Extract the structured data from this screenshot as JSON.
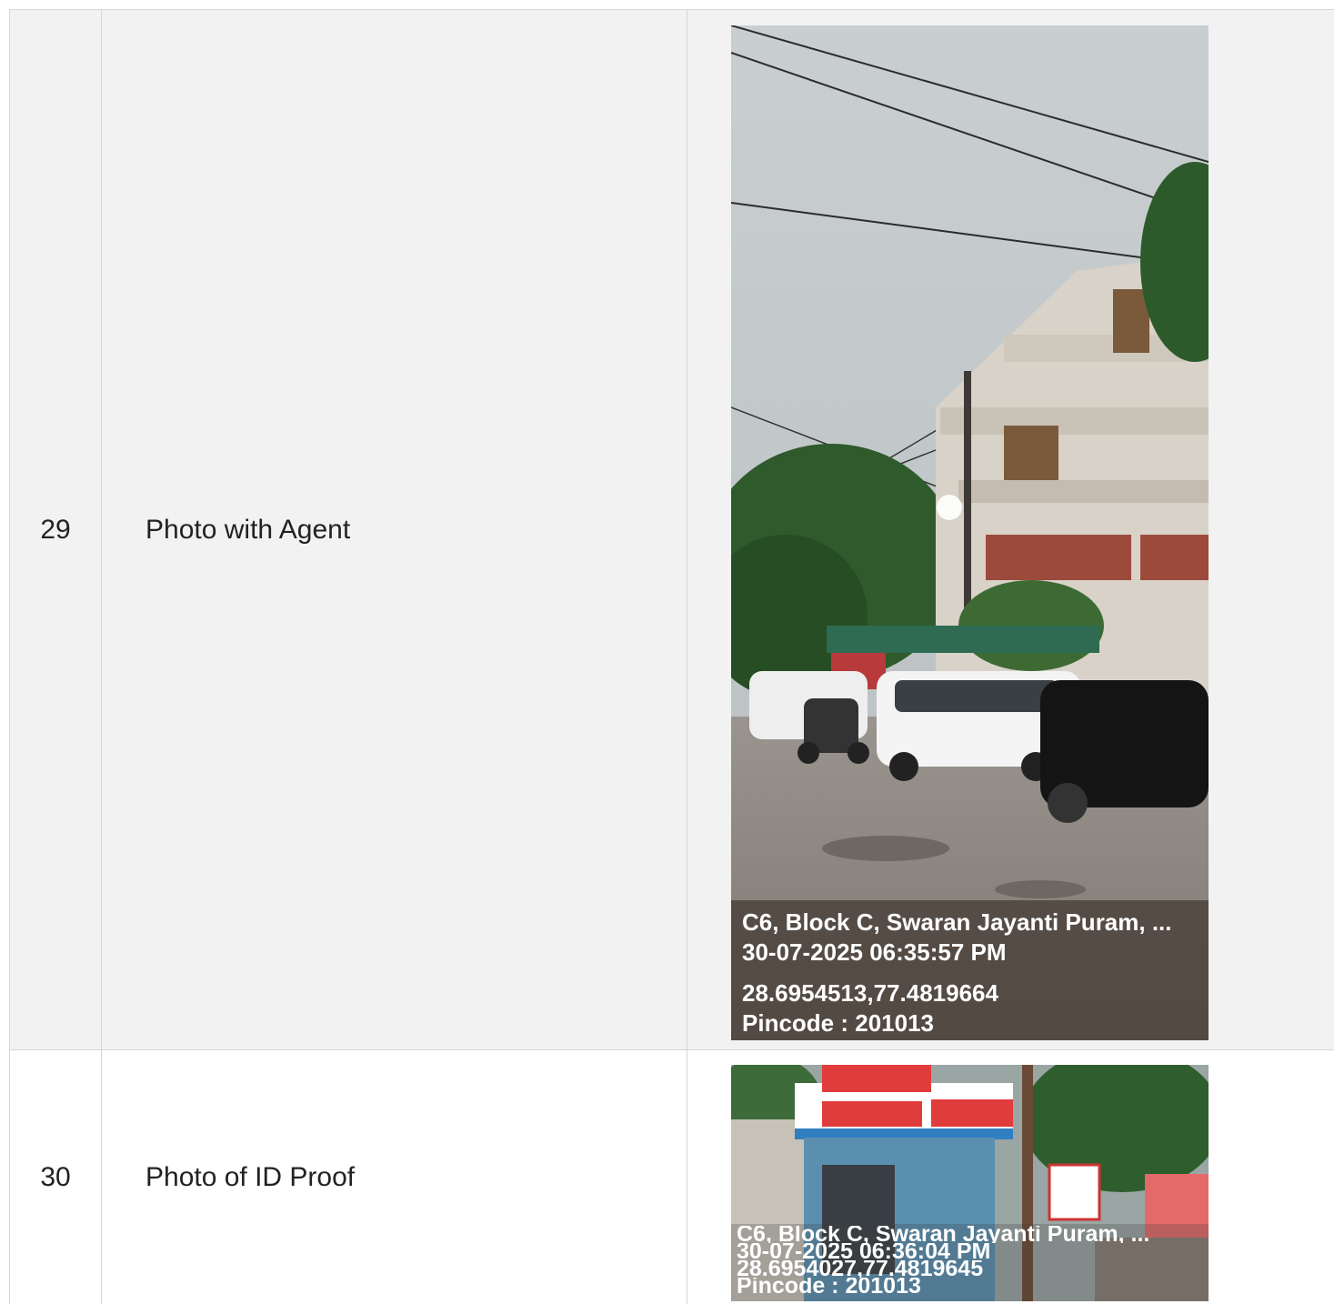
{
  "rows": [
    {
      "number": "29",
      "label": "Photo with Agent",
      "stamp": {
        "address": "C6, Block C, Swaran Jayanti Puram, ...",
        "datetime": "30-07-2025 06:35:57 PM",
        "coords": "28.6954513,77.4819664",
        "pincode": "Pincode : 201013"
      }
    },
    {
      "number": "30",
      "label": "Photo of ID Proof",
      "stamp": {
        "address": "C6, Block C, Swaran Jayanti Puram, ...",
        "datetime": "30-07-2025 06:36:04 PM",
        "coords": "28.6954027,77.4819645",
        "pincode": "Pincode : 201013"
      }
    }
  ]
}
